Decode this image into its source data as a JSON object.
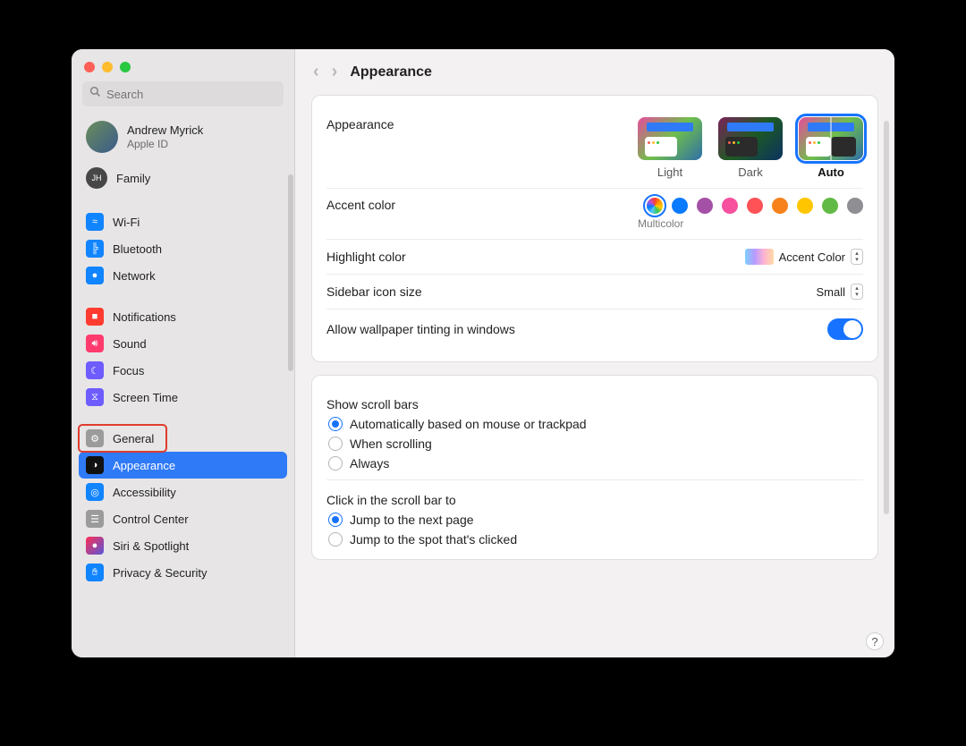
{
  "window": {
    "title": "Appearance"
  },
  "sidebar": {
    "search_placeholder": "Search",
    "user": {
      "name": "Andrew Myrick",
      "sub": "Apple ID",
      "family_label": "Family",
      "family_badge": "JH"
    },
    "groups": [
      {
        "items": [
          {
            "id": "wifi",
            "label": "Wi-Fi"
          },
          {
            "id": "bluetooth",
            "label": "Bluetooth"
          },
          {
            "id": "network",
            "label": "Network"
          }
        ]
      },
      {
        "items": [
          {
            "id": "notifications",
            "label": "Notifications"
          },
          {
            "id": "sound",
            "label": "Sound"
          },
          {
            "id": "focus",
            "label": "Focus"
          },
          {
            "id": "screentime",
            "label": "Screen Time"
          }
        ]
      },
      {
        "items": [
          {
            "id": "general",
            "label": "General",
            "boxed": true
          },
          {
            "id": "appearance",
            "label": "Appearance",
            "selected": true
          },
          {
            "id": "accessibility",
            "label": "Accessibility"
          },
          {
            "id": "controlcenter",
            "label": "Control Center"
          },
          {
            "id": "siri",
            "label": "Siri & Spotlight"
          },
          {
            "id": "privacy",
            "label": "Privacy & Security"
          }
        ]
      }
    ]
  },
  "appearance": {
    "section_label": "Appearance",
    "tiles": [
      {
        "id": "light",
        "label": "Light"
      },
      {
        "id": "dark",
        "label": "Dark"
      },
      {
        "id": "auto",
        "label": "Auto",
        "selected": true
      }
    ],
    "accent": {
      "label": "Accent color",
      "selected_label": "Multicolor",
      "colors": [
        "multicolor",
        "blue",
        "purple",
        "pink",
        "red",
        "orange",
        "yellow",
        "green",
        "graphite"
      ],
      "selected": "multicolor"
    },
    "highlight": {
      "label": "Highlight color",
      "value": "Accent Color"
    },
    "sidebar_icon": {
      "label": "Sidebar icon size",
      "value": "Small"
    },
    "tinting": {
      "label": "Allow wallpaper tinting in windows",
      "value": true
    }
  },
  "scroll": {
    "show_label": "Show scroll bars",
    "show_options": [
      {
        "label": "Automatically based on mouse or trackpad",
        "checked": true
      },
      {
        "label": "When scrolling",
        "checked": false
      },
      {
        "label": "Always",
        "checked": false
      }
    ],
    "click_label": "Click in the scroll bar to",
    "click_options": [
      {
        "label": "Jump to the next page",
        "checked": true
      },
      {
        "label": "Jump to the spot that's clicked",
        "checked": false
      }
    ]
  },
  "help_label": "?"
}
